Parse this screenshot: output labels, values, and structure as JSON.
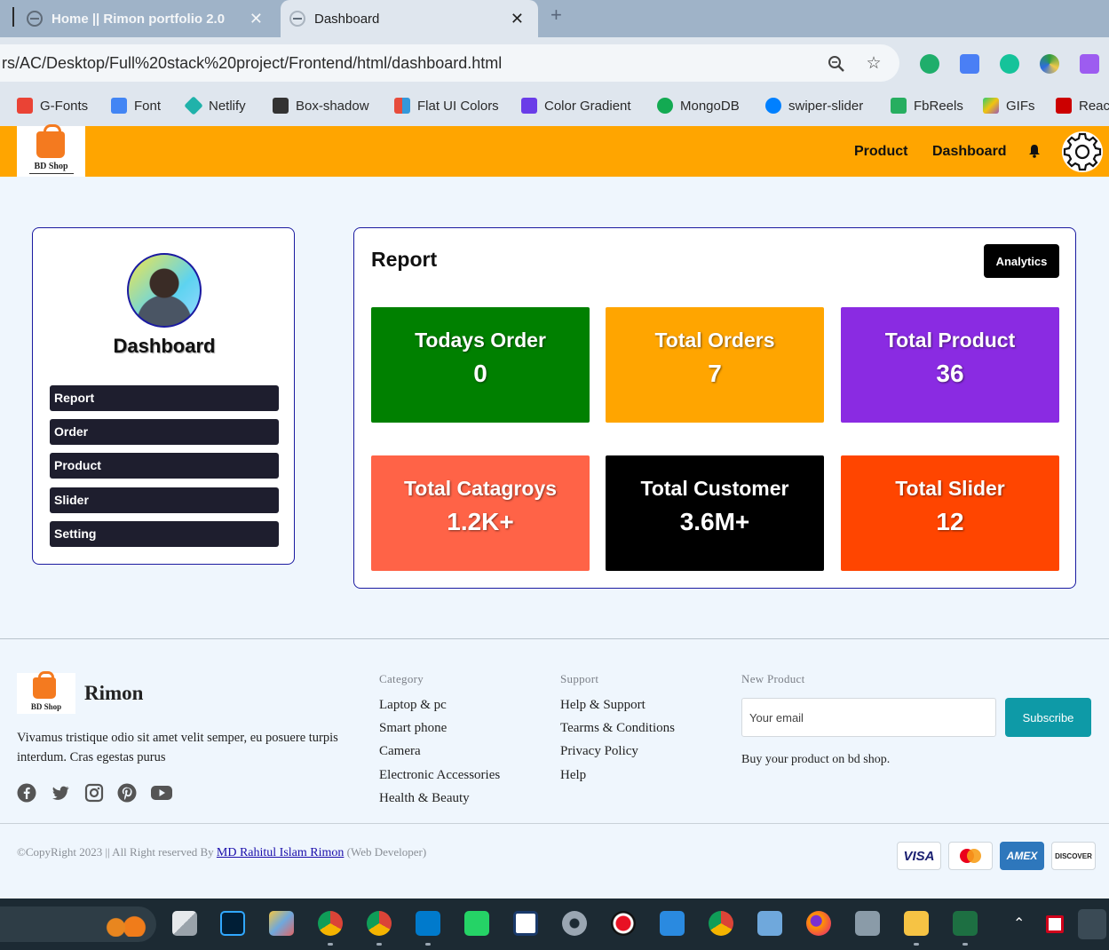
{
  "browser": {
    "tabs": [
      {
        "title": "Home || Rimon portfolio 2.0"
      },
      {
        "title": "Dashboard"
      }
    ],
    "url": "rs/AC/Desktop/Full%20stack%20project/Frontend/html/dashboard.html",
    "bookmarks": [
      {
        "label": "G-Fonts",
        "color": "#ea4335"
      },
      {
        "label": "Font",
        "color": "#4285f4"
      },
      {
        "label": "Netlify",
        "color": "#20b2aa"
      },
      {
        "label": "Box-shadow",
        "color": "#333333"
      },
      {
        "label": "Flat UI Colors",
        "color": "#f39c12"
      },
      {
        "label": "Color Gradient",
        "color": "#6a3de8"
      },
      {
        "label": "MongoDB",
        "color": "#13aa52"
      },
      {
        "label": "swiper-slider",
        "color": "#0080ff"
      },
      {
        "label": "FbReels",
        "color": "#27ae60"
      },
      {
        "label": "GIFs",
        "color": "#9b59b6"
      },
      {
        "label": "Reac",
        "color": "#cc0000"
      }
    ]
  },
  "site_nav": {
    "logo_text": "BD Shop",
    "links": [
      "Product",
      "Dashboard"
    ]
  },
  "sidebar": {
    "title": "Dashboard",
    "items": [
      "Report",
      "Order",
      "Product",
      "Slider",
      "Setting"
    ]
  },
  "report": {
    "title": "Report",
    "analytics_button": "Analytics",
    "stats": [
      {
        "label": "Todays Order",
        "value": "0",
        "color": "#008000"
      },
      {
        "label": "Total Orders",
        "value": "7",
        "color": "#ffa500"
      },
      {
        "label": "Total Product",
        "value": "36",
        "color": "#8a2be2"
      },
      {
        "label": "Total Catagroys",
        "value": "1.2K+",
        "color": "#ff6347"
      },
      {
        "label": "Total Customer",
        "value": "3.6M+",
        "color": "#000000"
      },
      {
        "label": "Total Slider",
        "value": "12",
        "color": "#ff4500"
      }
    ]
  },
  "footer": {
    "logo_text": "BD Shop",
    "brand": "Rimon",
    "description": "Vivamus tristique odio sit amet velit semper, eu posuere turpis interdum. Cras egestas purus",
    "social": [
      "facebook-icon",
      "twitter-icon",
      "instagram-icon",
      "pinterest-icon",
      "youtube-icon"
    ],
    "category": {
      "heading": "Category",
      "links": [
        "Laptop & pc",
        "Smart phone",
        "Camera",
        "Electronic Accessories",
        "Health & Beauty"
      ]
    },
    "support": {
      "heading": "Support",
      "links": [
        "Help & Support",
        "Tearms & Conditions",
        "Privacy Policy",
        "Help"
      ]
    },
    "new_product": {
      "heading": "New Product",
      "email_placeholder": "Your email",
      "subscribe_label": "Subscribe",
      "note": "Buy your product on bd shop."
    },
    "copyright_prefix": "©CopyRight 2023 || All Right reserved By ",
    "copyright_author": "MD Rahitul Islam Rimon",
    "copyright_suffix": " (Web Developer)",
    "payments": [
      "VISA",
      "Mastercard",
      "AMEX",
      "DISCOVER"
    ]
  }
}
